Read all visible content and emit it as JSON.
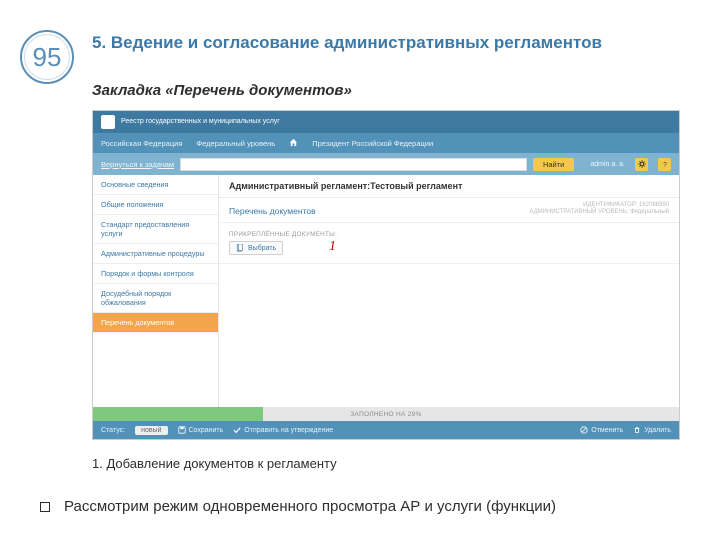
{
  "page_number": "95",
  "heading": "5. Ведение и согласование административных регламентов",
  "subheading": "Закладка «Перечень документов»",
  "caption1": "1. Добавление документов к регламенту",
  "bullet": "Рассмотрим режим одновременного просмотра АР и услуги (функции)",
  "callout1": "1",
  "screenshot": {
    "brand": "Реестр государственных и муниципальных услуг",
    "topbar": {
      "region": "Российская Федерация",
      "level": "Федеральный уровень",
      "president": "Президент Российской Федерации",
      "user": "admin a. a."
    },
    "back_link": "Вернуться к задачам",
    "find_btn": "Найти",
    "main_title": "Административный регламент:Тестовый регламент",
    "main_subtitle": "Перечень документов",
    "id_line1": "ИДЕНТИФИКАТОР: 162086990",
    "id_line2": "АДМИНИСТРАТИВНЫЙ УРОВЕНЬ: Федеральный",
    "attach_label": "ПРИКРЕПЛЁННЫЕ ДОКУМЕНТЫ:",
    "attach_btn": "Выбрать",
    "sidebar": [
      "Основные сведения",
      "Общие положения",
      "Стандарт предоставления услуги",
      "Административные процедуры",
      "Порядок и формы контроля",
      "Досудебный порядок обжалования",
      "Перечень документов"
    ],
    "progress_text": "ЗАПОЛНЕНО НА 29%",
    "footer": {
      "status_label": "Статус:",
      "status_value": "новый",
      "save": "Сохранить",
      "submit": "Отправить на утверждение",
      "cancel": "Отменить",
      "delete": "Удалить"
    }
  }
}
